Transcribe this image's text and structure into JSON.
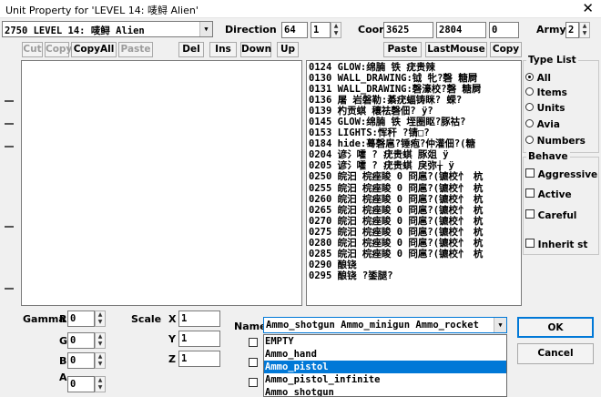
{
  "window": {
    "title": "Unit Property for 'LEVEL 14: 唛鲟 Alien'",
    "close_glyph": "✕"
  },
  "unit_combo": {
    "value": "2750 LEVEL 14: 唛鲟 Alien"
  },
  "direction": {
    "label": "Direction",
    "value1": "64",
    "value2": "1"
  },
  "coor": {
    "label": "Coor",
    "x": "3625",
    "y": "2804",
    "z": "0"
  },
  "army": {
    "label": "Army",
    "value": "2"
  },
  "edit_buttons": [
    "Cut",
    "Copy",
    "CopyAll",
    "Paste",
    "Del",
    "Ins",
    "Down",
    "Up"
  ],
  "edit_buttons_disabled": [
    true,
    true,
    false,
    true,
    false,
    false,
    false,
    false
  ],
  "right_buttons": [
    "Paste",
    "LastMouse",
    "Copy"
  ],
  "script_lines": [
    "0124 GLOW:绵腩 铁 疣贵辣",
    "0130 WALL_DRAWING:钺 牝?磬 糖屙",
    "0131 WALL_DRAWING:磬濠校?磬 糖屙",
    "0136 屠 岩磐勒:綦疣蝠铸眯?  蝾?",
    "0139 杓贡蜞 穰祛磬佃?  ÿ?",
    "0145 GLOW:绵腩 铁 垤圈眍?豚祜?",
    "0153 LIGHTS:恽秆   ?锖□?",
    "0184 hide:蓦磬扈?锤疱?仲灌佃?(糖",
    "0204 谚氵嚯  ? 疣贵蜞 豚爼   ÿ",
    "0205 谚氵嚯  ? 疣贵蜞 戾弥╁  ÿ",
    "0250 皖汩 梡痤睃 0 冏扈?(镳校忄 杭",
    "0255 皖汩 梡痤睃 0 冏扈?(镳校忄 杭",
    "0260 皖汩 梡痤睃 0 冏扈?(镳校忄 杭",
    "0265 皖汩 梡痤睃 0 冏扈?(镳校忄 杭",
    "0270 皖汩 梡痤睃 0 冏扈?(镳校忄 杭",
    "0275 皖汩 梡痤睃 0 冏扈?(镳校忄 杭",
    "0280 皖汩 梡痤睃 0 冏扈?(镳校忄 杭",
    "0285 皖汩 梡痤睃 0 冏扈?(镳校忄 杭",
    "0290 酿铙",
    "0295 酿铙  ?鋈腿?"
  ],
  "type_list": {
    "title": "Type List",
    "options": [
      "All",
      "Items",
      "Units",
      "Avia",
      "Numbers"
    ],
    "selected": "All"
  },
  "behave": {
    "title": "Behave",
    "options": [
      "Aggressive",
      "Active",
      "Careful",
      "Inherit st"
    ]
  },
  "gamma": {
    "label": "Gamma",
    "fields": [
      {
        "label": "R",
        "value": "0"
      },
      {
        "label": "G",
        "value": "0"
      },
      {
        "label": "B",
        "value": "0"
      },
      {
        "label": "A",
        "value": "0"
      }
    ]
  },
  "scale": {
    "label": "Scale",
    "fields": [
      {
        "label": "X",
        "value": "1"
      },
      {
        "label": "Y",
        "value": "1"
      },
      {
        "label": "Z",
        "value": "1"
      }
    ]
  },
  "name": {
    "label": "Name",
    "value": "Ammo_shotgun Ammo_minigun Ammo_rocket",
    "options": [
      "EMPTY",
      "Ammo_hand",
      "Ammo_pistol",
      "Ammo_pistol_infinite",
      "Ammo_shotgun"
    ],
    "selected": "Ammo_pistol"
  },
  "dialog_buttons": {
    "ok": "OK",
    "cancel": "Cancel"
  },
  "colors": {
    "selection": "#0078d7",
    "background": "#f0f0f0"
  }
}
